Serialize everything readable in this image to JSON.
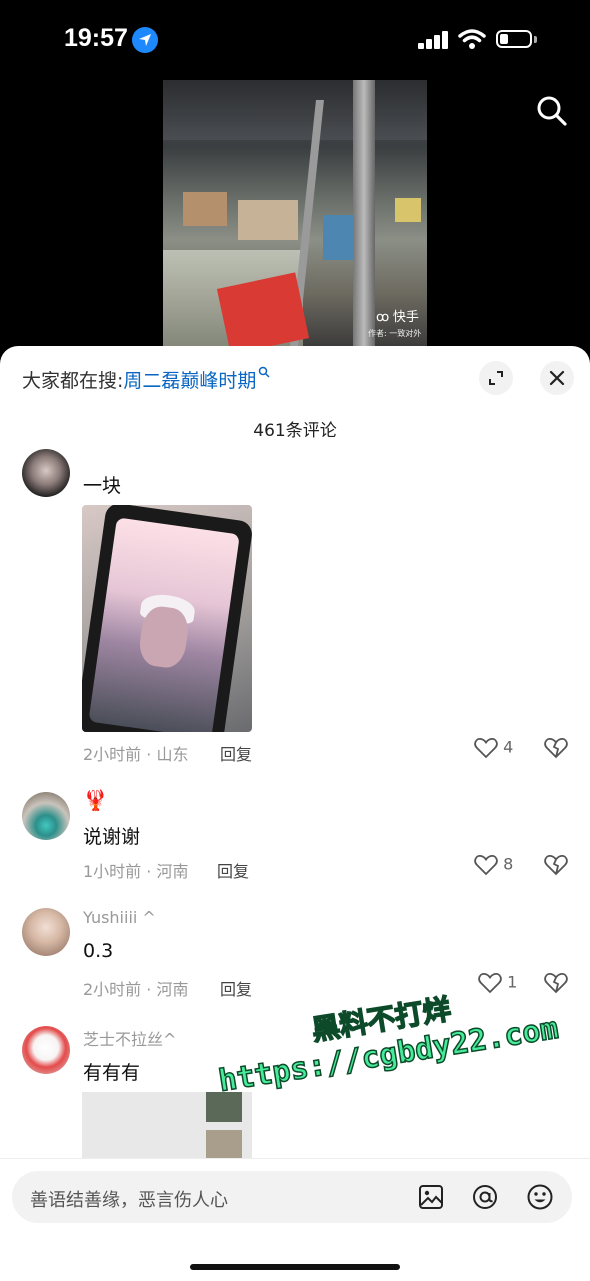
{
  "status_bar": {
    "time": "19:57"
  },
  "video": {
    "watermark_brand": "快手",
    "watermark_author": "作者: 一致对外"
  },
  "panel": {
    "search_prefix": "大家都在搜:",
    "search_term": "周二磊巅峰时期",
    "comment_count": "461条评论"
  },
  "comments": [
    {
      "username": "",
      "text": "一块",
      "meta": "2小时前 · 山东",
      "reply": "回复",
      "likes": "4",
      "has_image": true
    },
    {
      "username": "🦞",
      "text": "说谢谢",
      "meta": "1小时前 · 河南",
      "reply": "回复",
      "likes": "8"
    },
    {
      "username": "Yushiiii ^",
      "text": "0.3",
      "meta": "2小时前 · 河南",
      "reply": "回复",
      "likes": "1"
    },
    {
      "username": "芝士不拉丝^",
      "text": "有有有"
    }
  ],
  "input": {
    "placeholder": "善语结善缘，恶言伤人心"
  },
  "overlay_watermark": {
    "line1": "黑料不打烊",
    "line2": "https://cgbdy22.com"
  },
  "icons": [
    "location-icon",
    "signal-icon",
    "wifi-icon",
    "battery-icon",
    "search-icon",
    "expand-icon",
    "close-icon",
    "heart-icon",
    "broken-heart-icon",
    "image-icon",
    "at-icon",
    "emoji-icon"
  ]
}
